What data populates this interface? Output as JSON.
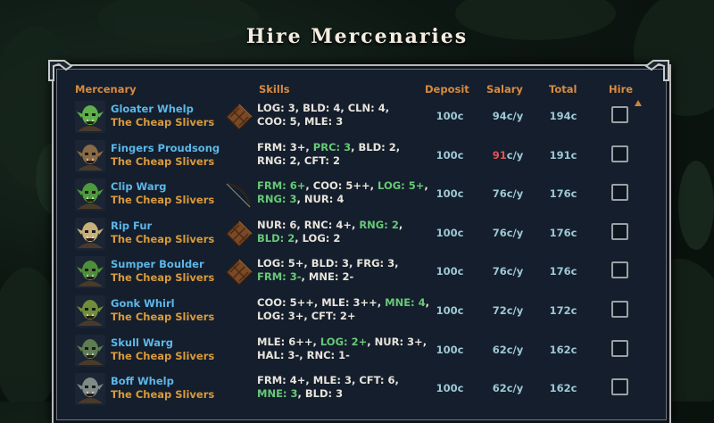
{
  "title": "Hire Mercenaries",
  "columns": {
    "mercenary": "Mercenary",
    "skills": "Skills",
    "deposit": "Deposit",
    "salary": "Salary",
    "total": "Total",
    "hire": "Hire"
  },
  "colors": {
    "name": "#5cb7e8",
    "group": "#d99a3c",
    "header": "#d88b40",
    "skill_highlight": "#67c977",
    "salary_warning": "#e05454"
  },
  "mercenaries": [
    {
      "name": "Gloater Whelp",
      "group": "The Cheap Slivers",
      "item_icon": "leather-armor-icon",
      "skills_line1": [
        [
          "LOG: 3",
          ""
        ],
        [
          ", BLD: 4, CLN: 4,",
          ""
        ]
      ],
      "skills_line2": [
        [
          "COO: 5",
          ""
        ],
        [
          ", MLE: 3",
          ""
        ]
      ],
      "deposit": "100c",
      "salary": "94c/y",
      "salary_warning": false,
      "total": "194c",
      "hired": false,
      "skin": "#5fb04a"
    },
    {
      "name": "Fingers Proudsong",
      "group": "The Cheap Slivers",
      "item_icon": "none",
      "skills_line1": [
        [
          "FRM: 3+, ",
          ""
        ],
        [
          "PRC: 3",
          "green"
        ],
        [
          ", BLD: 2,",
          ""
        ]
      ],
      "skills_line2": [
        [
          "RNG: 2, CFT: 2",
          ""
        ]
      ],
      "deposit": "100c",
      "salary": "91c/y",
      "salary_warning": true,
      "total": "191c",
      "hired": false,
      "skin": "#8a6a44"
    },
    {
      "name": "Clip Warg",
      "group": "The Cheap Slivers",
      "item_icon": "bow-icon",
      "skills_line1": [
        [
          "FRM: 6+",
          "green"
        ],
        [
          ", COO: 5++, ",
          ""
        ],
        [
          "LOG: 5+",
          "green"
        ],
        [
          ",",
          ""
        ]
      ],
      "skills_line2": [
        [
          "RNG: 3",
          "green"
        ],
        [
          ", NUR: 4",
          ""
        ]
      ],
      "deposit": "100c",
      "salary": "76c/y",
      "salary_warning": false,
      "total": "176c",
      "hired": false,
      "skin": "#4e9a3c"
    },
    {
      "name": "Rip Fur",
      "group": "The Cheap Slivers",
      "item_icon": "leather-armor-icon",
      "skills_line1": [
        [
          "NUR: 6, RNC: 4+, ",
          ""
        ],
        [
          "RNG: 2",
          "green"
        ],
        [
          ",",
          ""
        ]
      ],
      "skills_line2": [
        [
          "BLD: 2",
          "green"
        ],
        [
          ", LOG: 2",
          ""
        ]
      ],
      "deposit": "100c",
      "salary": "76c/y",
      "salary_warning": false,
      "total": "176c",
      "hired": false,
      "skin": "#c8b27a"
    },
    {
      "name": "Sumper Boulder",
      "group": "The Cheap Slivers",
      "item_icon": "leather-armor-icon",
      "skills_line1": [
        [
          "LOG: 5+, BLD: 3, FRG: 3,",
          ""
        ]
      ],
      "skills_line2": [
        [
          "FRM: 3-",
          "green"
        ],
        [
          ", MNE: 2-",
          ""
        ]
      ],
      "deposit": "100c",
      "salary": "76c/y",
      "salary_warning": false,
      "total": "176c",
      "hired": false,
      "skin": "#4f8f3a"
    },
    {
      "name": "Gonk Whirl",
      "group": "The Cheap Slivers",
      "item_icon": "none",
      "skills_line1": [
        [
          "COO: 5++, MLE: 3++, ",
          ""
        ],
        [
          "MNE: 4",
          "green"
        ],
        [
          ",",
          ""
        ]
      ],
      "skills_line2": [
        [
          "LOG: 3+, CFT: 2+",
          ""
        ]
      ],
      "deposit": "100c",
      "salary": "72c/y",
      "salary_warning": false,
      "total": "172c",
      "hired": false,
      "skin": "#6f8e3a"
    },
    {
      "name": "Skull Warg",
      "group": "The Cheap Slivers",
      "item_icon": "none",
      "skills_line1": [
        [
          "MLE: 6++, ",
          ""
        ],
        [
          "LOG: 2+",
          "green"
        ],
        [
          ", NUR: 3+,",
          ""
        ]
      ],
      "skills_line2": [
        [
          "HAL: 3-, RNC: 1-",
          ""
        ]
      ],
      "deposit": "100c",
      "salary": "62c/y",
      "salary_warning": false,
      "total": "162c",
      "hired": false,
      "skin": "#5f7c52"
    },
    {
      "name": "Boff Whelp",
      "group": "The Cheap Slivers",
      "item_icon": "none",
      "skills_line1": [
        [
          "FRM: 4+, MLE: 3, CFT: 6,",
          ""
        ]
      ],
      "skills_line2": [
        [
          "MNE: 3",
          "green"
        ],
        [
          ", BLD: 3",
          ""
        ]
      ],
      "deposit": "100c",
      "salary": "62c/y",
      "salary_warning": false,
      "total": "162c",
      "hired": false,
      "skin": "#7d8a86"
    }
  ]
}
